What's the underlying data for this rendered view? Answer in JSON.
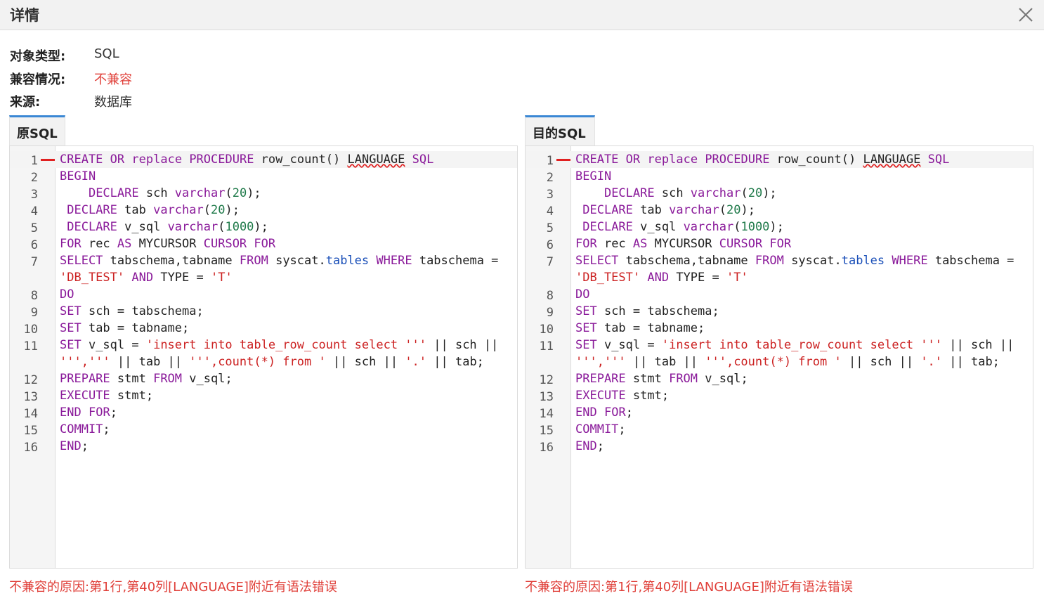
{
  "dialog": {
    "title": "详情"
  },
  "info": {
    "object_type_label": "对象类型:",
    "object_type_value": "SQL",
    "compat_label": "兼容情况:",
    "compat_value": "不兼容",
    "source_label": "来源:",
    "source_value": "数据库"
  },
  "tabs": {
    "source": "原SQL",
    "target": "目的SQL"
  },
  "line_numbers": [
    "1",
    "2",
    "3",
    "4",
    "5",
    "6",
    "7",
    "8",
    "9",
    "10",
    "11",
    "12",
    "13",
    "14",
    "15",
    "16"
  ],
  "code_lines": [
    "CREATE OR replace PROCEDURE row_count() LANGUAGE SQL",
    "BEGIN",
    "    DECLARE sch varchar(20);",
    " DECLARE tab varchar(20);",
    " DECLARE v_sql varchar(1000);",
    "FOR rec AS MYCURSOR CURSOR FOR",
    "SELECT tabschema,tabname FROM syscat.tables WHERE tabschema = 'DB_TEST' AND TYPE = 'T'",
    "DO",
    "SET sch = tabschema;",
    "SET tab = tabname;",
    "SET v_sql = 'insert into table_row_count select ''' || sch || ''',''' || tab || ''',count(*) from ' || sch || '.' || tab;",
    "PREPARE stmt FROM v_sql;",
    "EXECUTE stmt;",
    "END FOR;",
    "COMMIT;",
    "END;"
  ],
  "reasons": {
    "source": "不兼容的原因:第1行,第40列[LANGUAGE]附近有语法错误",
    "target": "不兼容的原因:第1行,第40列[LANGUAGE]附近有语法错误"
  },
  "colors": {
    "keyword": "#8a1a9a",
    "function": "#1a4fb8",
    "number": "#1f7a4a",
    "string": "#cc2222",
    "error": "#e02020",
    "accent": "#3a87d4"
  }
}
